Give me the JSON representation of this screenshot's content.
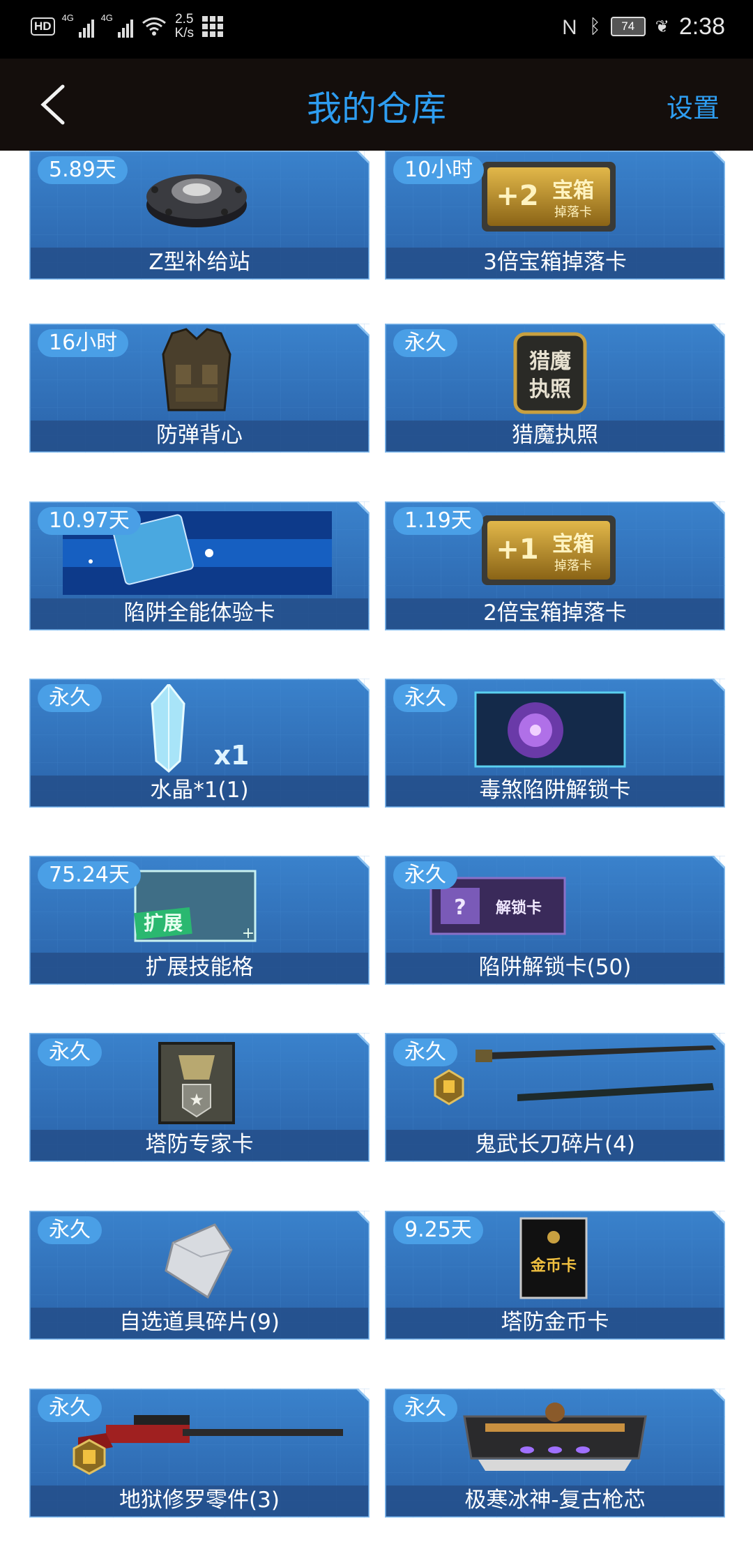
{
  "status_bar": {
    "hd": "HD",
    "sig1": "4G",
    "sig2": "4G",
    "speed_value": "2.5",
    "speed_unit": "K/s",
    "battery": "74",
    "time": "2:38"
  },
  "header": {
    "title": "我的仓库",
    "settings_label": "设置"
  },
  "items": [
    {
      "badge": "5.89天",
      "name": "Z型补给站",
      "icon": "supply-station-icon"
    },
    {
      "badge": "10小时",
      "name": "3倍宝箱掉落卡",
      "icon": "treasure-drop-card-plus2-icon"
    },
    {
      "badge": "16小时",
      "name": "防弹背心",
      "icon": "bulletproof-vest-icon"
    },
    {
      "badge": "永久",
      "name": "猎魔执照",
      "icon": "demon-hunter-license-icon"
    },
    {
      "badge": "10.97天",
      "name": "陷阱全能体验卡",
      "icon": "trap-trial-card-icon"
    },
    {
      "badge": "1.19天",
      "name": "2倍宝箱掉落卡",
      "icon": "treasure-drop-card-plus1-icon"
    },
    {
      "badge": "永久",
      "name": "水晶*1(1)",
      "icon": "crystal-icon",
      "art_label": "x1"
    },
    {
      "badge": "永久",
      "name": "毒煞陷阱解锁卡",
      "icon": "poison-trap-unlock-card-icon"
    },
    {
      "badge": "75.24天",
      "name": "扩展技能格",
      "icon": "skill-slot-expand-icon",
      "art_label": "扩展"
    },
    {
      "badge": "永久",
      "name": "陷阱解锁卡(50)",
      "icon": "trap-unlock-card-icon",
      "art_label": "解锁卡"
    },
    {
      "badge": "永久",
      "name": "塔防专家卡",
      "icon": "tower-defense-expert-card-icon"
    },
    {
      "badge": "永久",
      "name": "鬼武长刀碎片(4)",
      "icon": "katana-fragment-icon"
    },
    {
      "badge": "永久",
      "name": "自选道具碎片(9)",
      "icon": "item-fragment-icon"
    },
    {
      "badge": "9.25天",
      "name": "塔防金币卡",
      "icon": "gold-coin-card-icon",
      "art_label": "金币卡"
    },
    {
      "badge": "永久",
      "name": "地狱修罗零件(3)",
      "icon": "sniper-rifle-part-icon"
    },
    {
      "badge": "永久",
      "name": "极寒冰神-复古枪芯",
      "icon": "gun-core-icon"
    }
  ],
  "art_text": {
    "license_line1": "猎魔",
    "license_line2": "执照",
    "plus2": "+2",
    "plus1": "+1",
    "box_line1": "宝箱",
    "box_line2": "掉落卡"
  },
  "colors": {
    "accent": "#2e9df0",
    "card_blue": "#2f6fb6",
    "badge": "#4a9fe6",
    "header_bg": "#140e0c"
  }
}
